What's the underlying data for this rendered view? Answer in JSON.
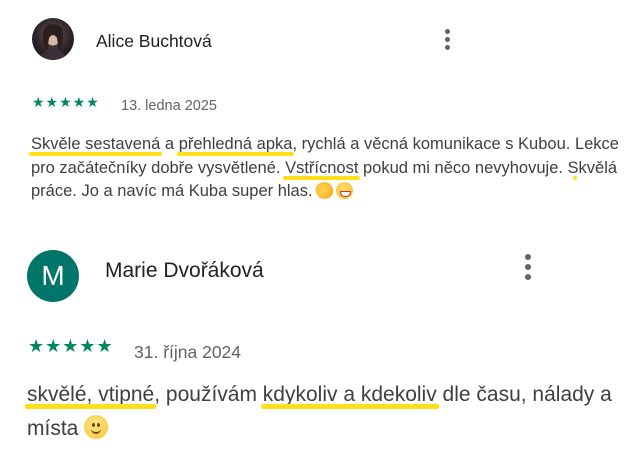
{
  "reviews": [
    {
      "author": "Alice Buchtová",
      "stars": "★★★★★",
      "date": "13. ledna 2025",
      "text": {
        "p1": "Skvěle sestavená",
        "p2": " a ",
        "p3": "přehledná apka",
        "p4": ", rychlá a věcná komunikace s Kubou. ",
        "p5": "Lekce pro začátečníky",
        "p6": " dobře vysvětlené. ",
        "p7": "Vstřícnost",
        "p8": " pokud mi něco nevyhovuje. Skvělá práce. Jo a navíc má Kuba super hlas."
      }
    },
    {
      "author": "Marie Dvořáková",
      "avatar_letter": "M",
      "stars": "★★★★★",
      "date": "31. října 2024",
      "text": {
        "p1": "skvělé, vtipné",
        "p2": ", používám ",
        "p3": "kdykoliv a kdekoliv",
        "p4": " dle času, nálady a místa"
      }
    }
  ],
  "colors": {
    "highlight": "#ffde1a",
    "star": "#01875f",
    "avatar_bg": "#00766a"
  }
}
